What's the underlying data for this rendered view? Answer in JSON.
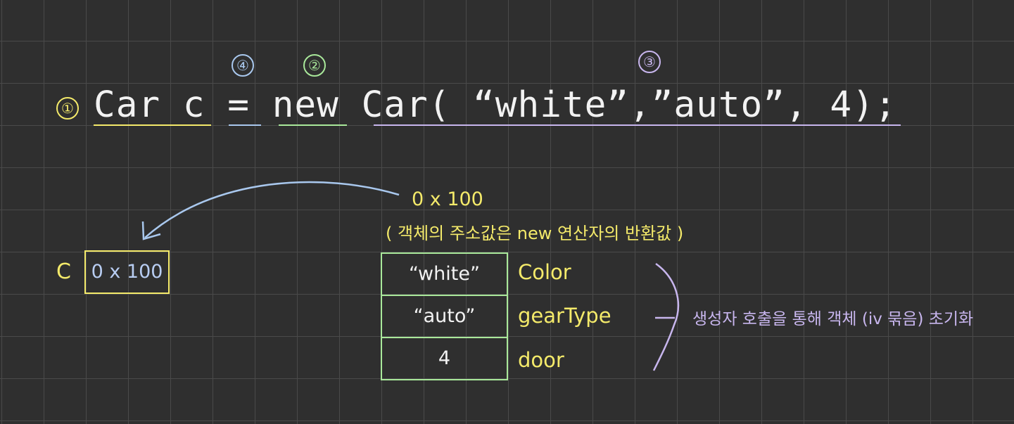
{
  "code": {
    "line": "Car c = new Car( “white”,”auto”, 4);",
    "parts": [
      "Car",
      " ",
      "c",
      " ",
      "=",
      " ",
      "new",
      " ",
      "Car( “white”,”auto”, 4)",
      ";"
    ]
  },
  "steps": {
    "step1": "①",
    "step2": "②",
    "step3": "③",
    "step4": "④"
  },
  "colors": {
    "yellow": "#f4ea6a",
    "blue": "#a9c8ee",
    "green": "#a9e89a",
    "purple": "#c8b6ee",
    "background": "#2f2f2f",
    "text": "#f2f2f2"
  },
  "reference": {
    "var_name": "C",
    "value": "0 x 100"
  },
  "address": {
    "label": "0 x 100",
    "note": "( 객체의 주소값은 new 연산자의 반환값 )"
  },
  "object": {
    "cells": [
      "“white”",
      "“auto”",
      "4"
    ],
    "fields": [
      "Color",
      "gearType",
      "door"
    ]
  },
  "constructor_note": "생성자 호출을 통해 객체 (iv 묶음) 초기화"
}
